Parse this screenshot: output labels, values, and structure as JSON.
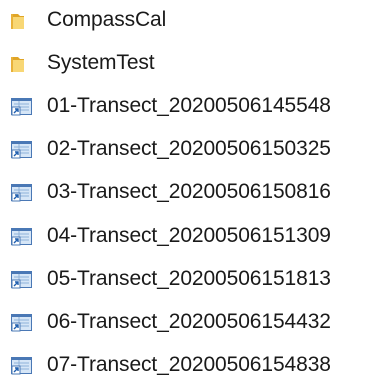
{
  "files": [
    {
      "name": "CompassCal",
      "type": "folder",
      "icon": "folder-icon"
    },
    {
      "name": "SystemTest",
      "type": "folder",
      "icon": "folder-icon"
    },
    {
      "name": "01-Transect_20200506145548",
      "type": "shortcut",
      "icon": "shortcut-icon"
    },
    {
      "name": "02-Transect_20200506150325",
      "type": "shortcut",
      "icon": "shortcut-icon"
    },
    {
      "name": "03-Transect_20200506150816",
      "type": "shortcut",
      "icon": "shortcut-icon"
    },
    {
      "name": "04-Transect_20200506151309",
      "type": "shortcut",
      "icon": "shortcut-icon"
    },
    {
      "name": "05-Transect_20200506151813",
      "type": "shortcut",
      "icon": "shortcut-icon"
    },
    {
      "name": "06-Transect_20200506154432",
      "type": "shortcut",
      "icon": "shortcut-icon"
    },
    {
      "name": "07-Transect_20200506154838",
      "type": "shortcut",
      "icon": "shortcut-icon"
    }
  ],
  "colors": {
    "folder_body": "#F8D775",
    "folder_back": "#E0A526",
    "shortcut_frame": "#4A78B5",
    "shortcut_panel": "#D6E6F7",
    "shortcut_arrow": "#1F5FAF",
    "text": "#1A1A1A"
  }
}
